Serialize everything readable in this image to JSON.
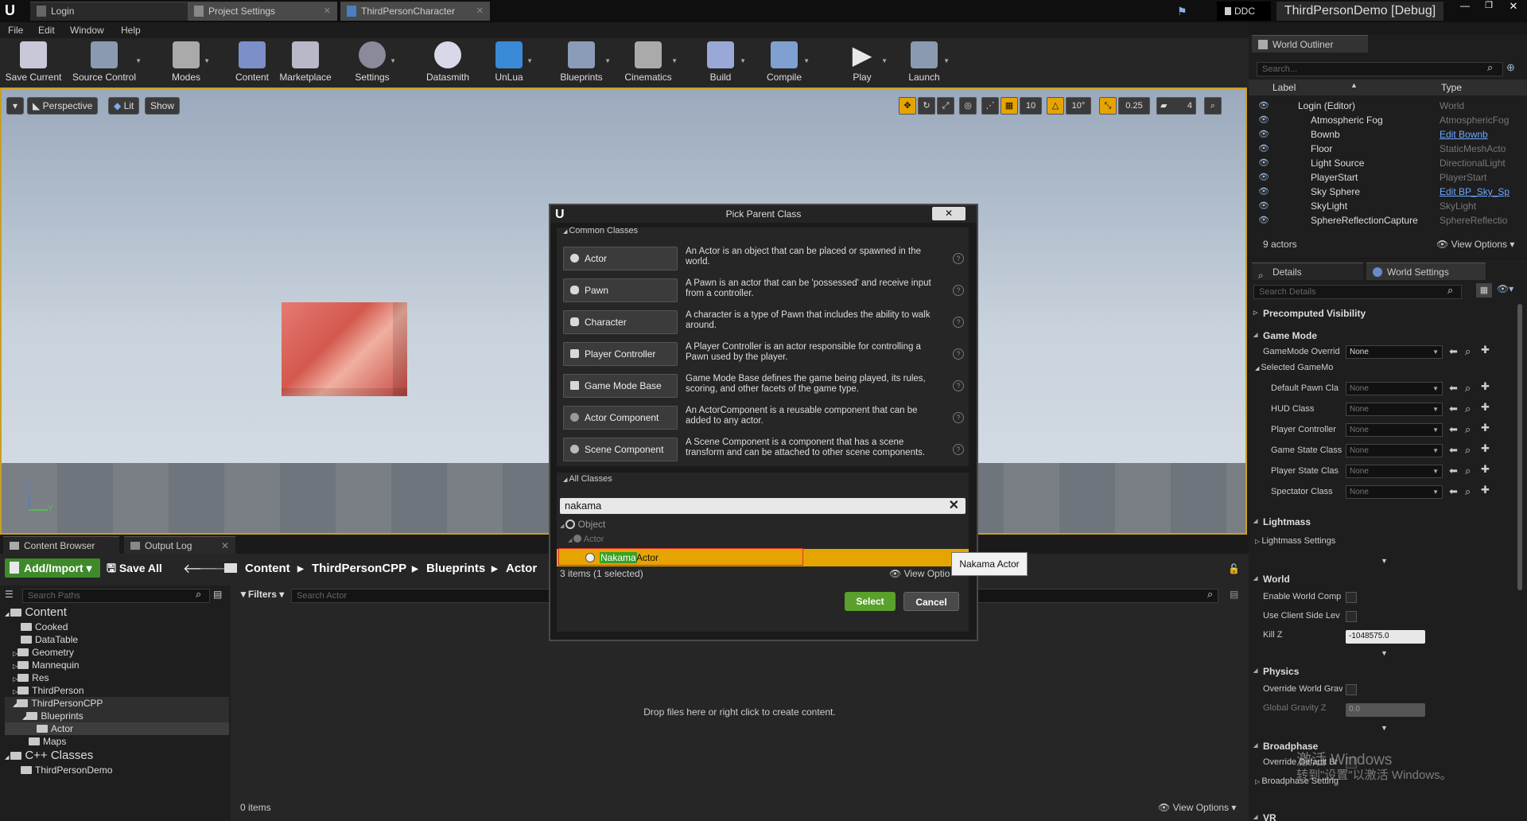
{
  "titlebar": {
    "tabs": [
      {
        "label": "Login"
      },
      {
        "label": "Project Settings"
      },
      {
        "label": "ThirdPersonCharacter"
      }
    ],
    "ddc": "DDC",
    "project": "ThirdPersonDemo [Debug]"
  },
  "menu": [
    "File",
    "Edit",
    "Window",
    "Help"
  ],
  "toolbar": [
    "Save Current",
    "Source Control",
    "Modes",
    "Content",
    "Marketplace",
    "Settings",
    "Datasmith",
    "UnLua",
    "Blueprints",
    "Cinematics",
    "Build",
    "Compile",
    "Play",
    "Launch"
  ],
  "viewport": {
    "perspective": "Perspective",
    "lit": "Lit",
    "show": "Show",
    "grid_snap": "10",
    "rot_snap": "10°",
    "scale_snap": "0.25",
    "cam_speed": "4"
  },
  "outliner": {
    "tab": "World Outliner",
    "search_placeholder": "Search...",
    "col_label": "Label",
    "col_type": "Type",
    "rows": [
      {
        "label": "Login (Editor)",
        "type": "World"
      },
      {
        "label": "Atmospheric Fog",
        "type": "AtmosphericFog"
      },
      {
        "label": "Bownb",
        "type": "Edit Bownb"
      },
      {
        "label": "Floor",
        "type": "StaticMeshActo"
      },
      {
        "label": "Light Source",
        "type": "DirectionalLight"
      },
      {
        "label": "PlayerStart",
        "type": "PlayerStart"
      },
      {
        "label": "Sky Sphere",
        "type": "Edit BP_Sky_Sp"
      },
      {
        "label": "SkyLight",
        "type": "SkyLight"
      },
      {
        "label": "SphereReflectionCapture",
        "type": "SphereReflectio"
      }
    ],
    "count": "9 actors",
    "view_options": "View Options"
  },
  "details": {
    "tab_details": "Details",
    "tab_world": "World Settings",
    "search_placeholder": "Search Details",
    "sections": {
      "precomputed": "Precomputed Visibility",
      "game_mode": "Game Mode",
      "lightmass": "Lightmass",
      "lightmass_settings": "Lightmass Settings",
      "world": "World",
      "physics": "Physics",
      "broadphase": "Broadphase",
      "broadphase_settings": "Broadphase Setting",
      "vr": "VR"
    },
    "gm": {
      "override": "GameMode Overrid",
      "selected": "Selected GameMo",
      "pawn": "Default Pawn Cla",
      "hud": "HUD Class",
      "pc": "Player Controller",
      "gs": "Game State Class",
      "ps": "Player State Clas",
      "spec": "Spectator Class",
      "none": "None"
    },
    "world": {
      "enable": "Enable World Comp",
      "client": "Use Client Side Lev",
      "killz": "Kill Z",
      "killz_val": "-1048575.0"
    },
    "physics": {
      "override": "Override World Grav",
      "gravity": "Global Gravity Z",
      "gravity_val": "0.0"
    },
    "broad": {
      "override": "Override Default Br"
    }
  },
  "content_browser": {
    "tab": "Content Browser",
    "tab2": "Output Log",
    "add": "Add/Import",
    "save_all": "Save All",
    "path": [
      "Content",
      "ThirdPersonCPP",
      "Blueprints",
      "Actor"
    ],
    "search_paths": "Search Paths",
    "filters": "Filters",
    "search_actor": "Search Actor",
    "tree": [
      "Content",
      "Cooked",
      "DataTable",
      "Geometry",
      "Mannequin",
      "Res",
      "ThirdPerson",
      "ThirdPersonCPP",
      "Blueprints",
      "Actor",
      "Maps",
      "C++ Classes",
      "ThirdPersonDemo"
    ],
    "drop_hint": "Drop files here or right click to create content.",
    "items": "0 items",
    "view_options": "View Options"
  },
  "dialog": {
    "title": "Pick Parent Class",
    "common": "Common Classes",
    "classes": [
      {
        "name": "Actor",
        "desc": "An Actor is an object that can be placed or spawned in the world."
      },
      {
        "name": "Pawn",
        "desc": "A Pawn is an actor that can be 'possessed' and receive input from a controller."
      },
      {
        "name": "Character",
        "desc": "A character is a type of Pawn that includes the ability to walk around."
      },
      {
        "name": "Player Controller",
        "desc": "A Player Controller is an actor responsible for controlling a Pawn used by the player."
      },
      {
        "name": "Game Mode Base",
        "desc": "Game Mode Base defines the game being played, its rules, scoring, and other facets of the game type."
      },
      {
        "name": "Actor Component",
        "desc": "An ActorComponent is a reusable component that can be added to any actor."
      },
      {
        "name": "Scene Component",
        "desc": "A Scene Component is a component that has a scene transform and can be attached to other scene components."
      }
    ],
    "all": "All Classes",
    "filter": "nakama",
    "tree_object": "Object",
    "tree_actor": "Actor",
    "match": "Nakama",
    "match_rest": "Actor",
    "status": "3 items (1 selected)",
    "view_options": "View Optio",
    "select": "Select",
    "cancel": "Cancel"
  },
  "tooltip": "Nakama Actor",
  "watermark": {
    "line1": "激活 Windows",
    "line2": "转到\"设置\"以激活 Windows。"
  },
  "colors": {
    "accent": "#e6a400",
    "select": "#5aa02c",
    "link": "#6aa8ff"
  }
}
